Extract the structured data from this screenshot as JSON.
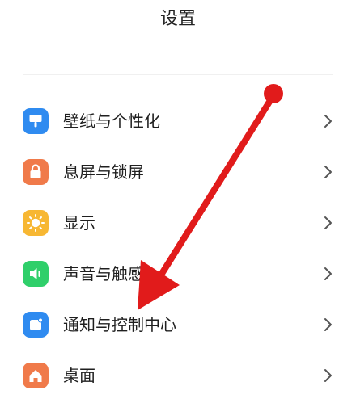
{
  "header": {
    "title": "设置"
  },
  "settings": {
    "items": [
      {
        "label": "壁纸与个性化",
        "icon": "wallpaper-icon",
        "color": "#2f8bf0"
      },
      {
        "label": "息屏与锁屏",
        "icon": "lock-icon",
        "color": "#f07a4a"
      },
      {
        "label": "显示",
        "icon": "sun-icon",
        "color": "#f7b733"
      },
      {
        "label": "声音与触感",
        "icon": "speaker-icon",
        "color": "#2fcf6a"
      },
      {
        "label": "通知与控制中心",
        "icon": "notification-icon",
        "color": "#2f8bf0"
      },
      {
        "label": "桌面",
        "icon": "home-icon",
        "color": "#f07a4a"
      }
    ]
  },
  "annotation": {
    "arrow_color": "#e11b1b"
  }
}
